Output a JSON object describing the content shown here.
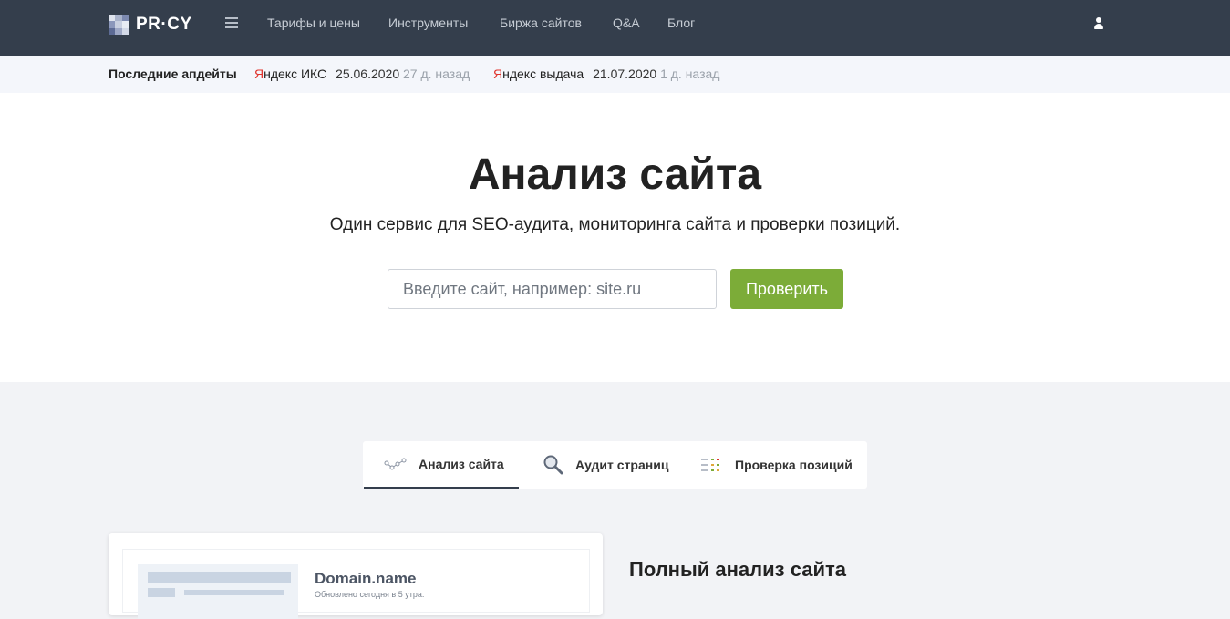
{
  "nav": {
    "logo_text": "PR·CY",
    "links": [
      "Тарифы и цены",
      "Инструменты",
      "Биржа сайтов",
      "Q&A",
      "Блог"
    ]
  },
  "updates": {
    "title": "Последние апдейты",
    "items": [
      {
        "first": "Я",
        "rest": "ндекс ИКС",
        "date": "25.06.2020",
        "ago": "27 д. назад"
      },
      {
        "first": "Я",
        "rest": "ндекс выдача",
        "date": "21.07.2020",
        "ago": "1 д. назад"
      }
    ]
  },
  "hero": {
    "title": "Анализ сайта",
    "subtitle": "Один сервис для SEO-аудита, мониторинга сайта и проверки позиций.",
    "placeholder": "Введите сайт, например: site.ru",
    "button": "Проверить"
  },
  "tabs": [
    {
      "label": "Анализ сайта",
      "icon": "graph-icon",
      "active": true
    },
    {
      "label": "Аудит страниц",
      "icon": "magnifier-icon",
      "active": false
    },
    {
      "label": "Проверка позиций",
      "icon": "list-icon",
      "active": false
    }
  ],
  "preview": {
    "domain": "Domain.name",
    "updated": "Обновлено сегодня в 5 утра."
  },
  "feature": {
    "title": "Полный анализ сайта"
  },
  "colors": {
    "nav_bg": "#343e4c",
    "accent_green": "#7cac38",
    "yandex_red": "#e0312a"
  }
}
